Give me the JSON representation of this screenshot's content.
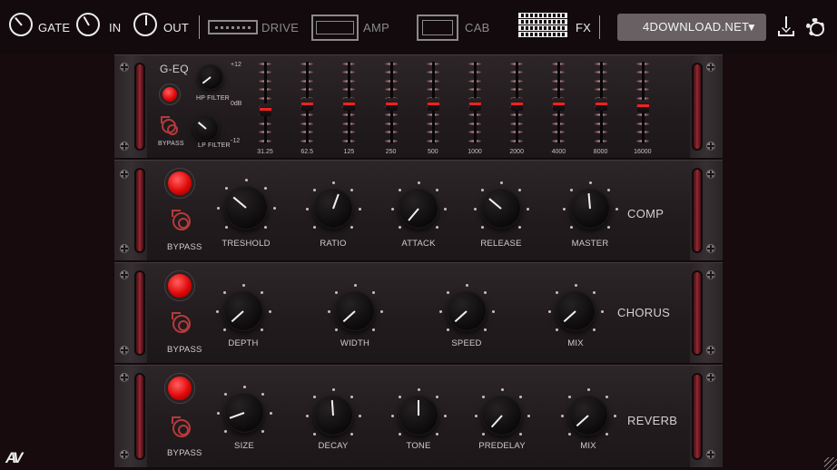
{
  "topbar": {
    "gate_label": "GATE",
    "in_label": "IN",
    "out_label": "OUT",
    "drive_label": "DRIVE",
    "amp_label": "AMP",
    "cab_label": "CAB",
    "fx_label": "FX",
    "preset_value": "4DOWNLOAD.NET",
    "preset_arrow": "▼",
    "icons": [
      "gate-knob-icon",
      "in-knob-icon",
      "out-knob-icon",
      "drive-pedal-icon",
      "amp-head-icon",
      "cab-icon",
      "fx-rack-icon",
      "download-icon",
      "gear-icon"
    ]
  },
  "geq": {
    "title": "G-EQ",
    "hp_label": "HP FILTER",
    "lp_label": "LP FILTER",
    "bypass_label": "BYPASS",
    "db_labels": [
      "+12",
      "0dB",
      "-12"
    ],
    "bands": [
      {
        "freq": "31.25",
        "gain": 0.42
      },
      {
        "freq": "62.5",
        "gain": 0.5
      },
      {
        "freq": "125",
        "gain": 0.5
      },
      {
        "freq": "250",
        "gain": 0.5
      },
      {
        "freq": "500",
        "gain": 0.5
      },
      {
        "freq": "1000",
        "gain": 0.5
      },
      {
        "freq": "2000",
        "gain": 0.5
      },
      {
        "freq": "4000",
        "gain": 0.5
      },
      {
        "freq": "8000",
        "gain": 0.5
      },
      {
        "freq": "16000",
        "gain": 0.48
      }
    ]
  },
  "comp": {
    "title": "COMP",
    "bypass_label": "BYPASS",
    "knobs": [
      "TRESHOLD",
      "RATIO",
      "ATTACK",
      "RELEASE",
      "MASTER"
    ]
  },
  "chorus": {
    "title": "CHORUS",
    "bypass_label": "BYPASS",
    "knobs": [
      "DEPTH",
      "WIDTH",
      "SPEED",
      "MIX"
    ]
  },
  "reverb": {
    "title": "REVERB",
    "bypass_label": "BYPASS",
    "knobs": [
      "SIZE",
      "DECAY",
      "TONE",
      "PREDELAY",
      "MIX"
    ]
  },
  "footer": {
    "logo": "AV"
  },
  "colors": {
    "accent": "#e00808",
    "handle": "#a02631",
    "panel": "#231d20",
    "preset_bg": "#686062"
  }
}
